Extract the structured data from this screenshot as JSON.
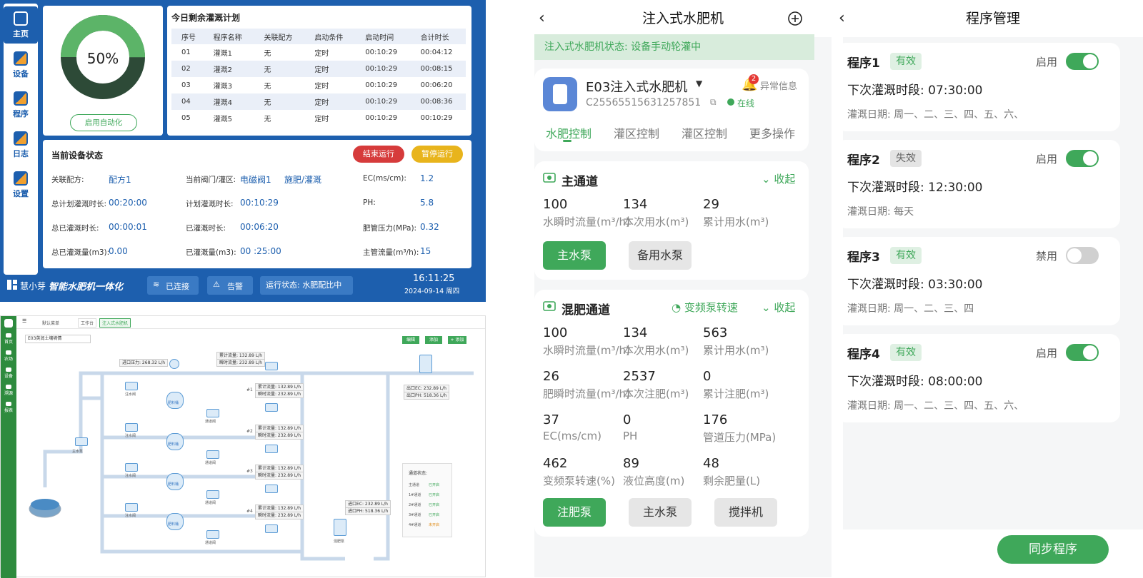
{
  "panelA": {
    "nav": [
      {
        "label": "主页",
        "icon": "home-icon"
      },
      {
        "label": "设备",
        "icon": "device-icon"
      },
      {
        "label": "程序",
        "icon": "program-icon"
      },
      {
        "label": "日志",
        "icon": "log-icon"
      },
      {
        "label": "设置",
        "icon": "settings-icon"
      }
    ],
    "progress": {
      "text": "50%",
      "value": 0.5
    },
    "auto_button": "启用自动化",
    "plan": {
      "title": "今日剩余灌溉计划",
      "headers": [
        "序号",
        "程序名称",
        "关联配方",
        "启动条件",
        "启动时间",
        "合计时长"
      ],
      "rows": [
        [
          "01",
          "灌溉1",
          "无",
          "定时",
          "00:10:29",
          "00:04:12"
        ],
        [
          "02",
          "灌溉2",
          "无",
          "定时",
          "00:10:29",
          "00:08:15"
        ],
        [
          "03",
          "灌溉3",
          "无",
          "定时",
          "00:10:29",
          "00:06:20"
        ],
        [
          "04",
          "灌溉4",
          "无",
          "定时",
          "00:10:29",
          "00:08:36"
        ],
        [
          "05",
          "灌溉5",
          "无",
          "定时",
          "00:10:29",
          "00:10:29"
        ]
      ]
    },
    "status": {
      "title": "当前设备状态",
      "stop": "结束运行",
      "pause": "暂停运行",
      "c1": [
        [
          "关联配方:",
          "配方1"
        ],
        [
          "总计划灌溉时长:",
          "00:20:00"
        ],
        [
          "总已灌溉时长:",
          "00:00:01"
        ],
        [
          "总已灌溉量(m3):",
          "0.00"
        ]
      ],
      "c2": [
        [
          "当前阀门/灌区:",
          "电磁阀1"
        ],
        [
          "计划灌溉时长:",
          "00:10:29"
        ],
        [
          "已灌溉时长:",
          "00:06:20"
        ],
        [
          "已灌溉量(m3):",
          "00 :25:00"
        ]
      ],
      "c2extra": "施肥/灌溉",
      "c3": [
        [
          "EC(ms/cm):",
          "1.2"
        ],
        [
          "PH:",
          "5.8"
        ],
        [
          "肥管压力(MPa):",
          "0.32"
        ],
        [
          "主管流量(m³/h):",
          "15"
        ]
      ]
    },
    "footer": {
      "brand": "慧小芽",
      "product": "智能水肥机一体化",
      "connected": "已连接",
      "alarm": "告警",
      "run_state": "运行状态: 水肥配比中",
      "time": "16:11:25",
      "date": "2024-09-14  周四"
    }
  },
  "panelB": {
    "tabs": [
      "默认菜单",
      "工作台",
      "注入式水肥机"
    ],
    "device_select": "E03英润土壤墒情",
    "actions": [
      "编辑",
      "添加",
      "+ 添加"
    ],
    "side": [
      "首页",
      "农场",
      "设备",
      "溯源",
      "报表"
    ],
    "labels": {
      "inlet": "进口压力: 268.32 L/h",
      "flow_top": [
        "累计流量: 132.89 L/h",
        "瞬时流量: 232.89 L/h"
      ],
      "outlet": [
        "出口EC: 232.89 L/h",
        "出口PH: 518.36 L/h"
      ],
      "channels": [
        "#1",
        "#2",
        "#3",
        "#4"
      ],
      "chan_flow": [
        "累计流量: 132.89 L/h",
        "瞬时流量: 232.89 L/h"
      ],
      "valve": "注水阀",
      "tank": "肥料桶",
      "pump": "主水泵",
      "pass": "通道阀",
      "mix": "混肥泵",
      "inlet2": [
        "进口EC: 232.89 L/h",
        "进口PH: 518.36 L/h"
      ],
      "ch_title": "通道状态:",
      "ch_rows": [
        [
          "主通道",
          "已开启"
        ],
        [
          "1#通道",
          "已开启"
        ],
        [
          "2#通道",
          "已开启"
        ],
        [
          "3#通道",
          "已开启"
        ],
        [
          "4#通道",
          "未开启"
        ]
      ]
    }
  },
  "panelC": {
    "title": "注入式水肥机",
    "banner": "注入式水肥机状态: 设备手动轮灌中",
    "device": {
      "name": "E03注入式水肥机",
      "serial": "C25565515631257851",
      "online": "在线",
      "alert": "异常信息",
      "alert_count": "2"
    },
    "tabs": [
      "水肥控制",
      "灌区控制",
      "灌区控制",
      "更多操作"
    ],
    "main": {
      "title": "主通道",
      "collapse": "收起",
      "stats": [
        [
          "100",
          "水瞬时流量(m³/h)"
        ],
        [
          "134",
          "本次用水(m³)"
        ],
        [
          "29",
          "累计用水(m³)"
        ]
      ],
      "buttons": [
        "主水泵",
        "备用水泵"
      ]
    },
    "mix": {
      "title": "混肥通道",
      "vfd": "变频泵转速",
      "collapse": "收起",
      "stats": [
        [
          "100",
          "水瞬时流量(m³/h)"
        ],
        [
          "134",
          "本次用水(m³)"
        ],
        [
          "563",
          "累计用水(m³)"
        ],
        [
          "26",
          "肥瞬时流量(m³/h)"
        ],
        [
          "2537",
          "本次注肥(m³)"
        ],
        [
          "0",
          "累计注肥(m³)"
        ],
        [
          "37",
          "EC(ms/cm)"
        ],
        [
          "0",
          "PH"
        ],
        [
          "176",
          "管道压力(MPa)"
        ],
        [
          "462",
          "变频泵转速(%)"
        ],
        [
          "89",
          "液位高度(m)"
        ],
        [
          "48",
          "剩余肥量(L)"
        ]
      ],
      "buttons": [
        "注肥泵",
        "主水泵",
        "搅拌机"
      ]
    },
    "colors": {
      "green": "#3fa85a"
    }
  },
  "panelD": {
    "title": "程序管理",
    "programs": [
      {
        "name": "程序1",
        "status": "有效",
        "switch_label": "启用",
        "on": true,
        "next": "下次灌溉时段:  07:30:00",
        "days": "灌溉日期: 周一、二、三、四、五、六、"
      },
      {
        "name": "程序2",
        "status": "失效",
        "switch_label": "启用",
        "on": true,
        "next": "下次灌溉时段:  12:30:00",
        "days": "灌溉日期: 每天"
      },
      {
        "name": "程序3",
        "status": "有效",
        "switch_label": "禁用",
        "on": false,
        "next": "下次灌溉时段:  03:30:00",
        "days": "灌溉日期: 周一、二、三、四"
      },
      {
        "name": "程序4",
        "status": "有效",
        "switch_label": "启用",
        "on": true,
        "next": "下次灌溉时段:  08:00:00",
        "days": "灌溉日期: 周一、二、三、四、五、六、"
      }
    ],
    "sync": "同步程序"
  }
}
